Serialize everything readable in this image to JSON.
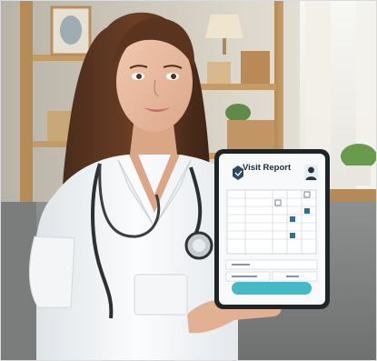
{
  "tablet": {
    "title": "Visit Report",
    "subtitle": "",
    "cta_label": "",
    "colors": {
      "accent": "#46b9c6",
      "screen": "#f7f9fb",
      "bezel": "#1f2427"
    }
  },
  "icons": [
    "shield-icon",
    "person-icon",
    "bell-icon",
    "checkbox-icon"
  ]
}
